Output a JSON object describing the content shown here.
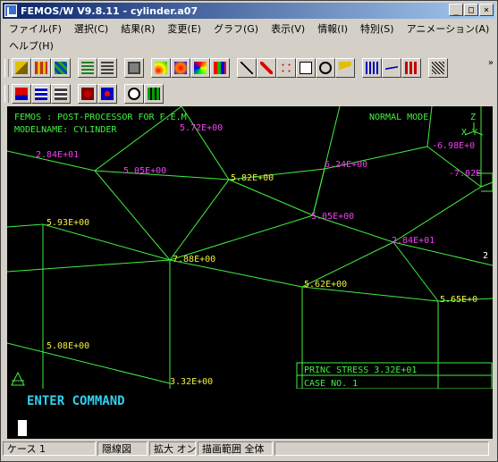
{
  "window": {
    "title": "FEMOS/W V9.8.11 - cylinder.a07",
    "min": "_",
    "max": "□",
    "close": "×"
  },
  "menu": {
    "row1": [
      "ファイル(F)",
      "選択(C)",
      "結果(R)",
      "変更(E)",
      "グラフ(G)",
      "表示(V)",
      "情報(I)",
      "特別(S)",
      "アニメーション(A)"
    ],
    "row2": [
      "ヘルプ(H)"
    ]
  },
  "toolbar": {
    "row1": [
      "open-icon",
      "grid-icon",
      "mesh-icon",
      "layers-icon",
      "layers2-icon",
      "print-icon",
      "contour1-icon",
      "contour2-icon",
      "contour3-icon",
      "contour4-icon",
      "vector-icon",
      "arrow-icon",
      "scatter-icon",
      "l33-icon",
      "circle-icon",
      "deform-icon",
      "graph1-icon",
      "graph2-icon",
      "graph3-icon",
      "spring-icon"
    ],
    "row2": [
      "down-icon",
      "stack-icon",
      "stack-down-icon",
      "gear-icon",
      "move-icon",
      "zoom-icon",
      "fit-icon"
    ],
    "more": "»"
  },
  "canvas": {
    "header_left1": "FEMOS  : POST-PROCESSOR  FOR F.E.M",
    "header_left2": "MODELNAME: CYLINDER",
    "header_right": "NORMAL MODE",
    "axis_z": "Z",
    "axis_xy": "X  Y",
    "labels": [
      {
        "text": "5.72E+00",
        "color": "#f040f0"
      },
      {
        "text": "2.84E+01",
        "color": "#f040f0"
      },
      {
        "text": "5.05E+00",
        "color": "#f040f0"
      },
      {
        "text": "5.82E+00",
        "color": "#f0f040"
      },
      {
        "text": "6.24E+00",
        "color": "#f040f0"
      },
      {
        "text": "-6.98E+0",
        "color": "#f040f0"
      },
      {
        "text": "-7.02E",
        "color": "#f040f0"
      },
      {
        "text": "5.93E+00",
        "color": "#f0f040"
      },
      {
        "text": "5.05E+00",
        "color": "#f040f0"
      },
      {
        "text": "7.88E+00",
        "color": "#f0f040"
      },
      {
        "text": "2.84E+01",
        "color": "#f040f0"
      },
      {
        "text": "5.62E+00",
        "color": "#f0f040"
      },
      {
        "text": "5.65E+0",
        "color": "#f0f040"
      },
      {
        "text": "5.08E+00",
        "color": "#f0f040"
      },
      {
        "text": "3.32E+00",
        "color": "#f0f040"
      },
      {
        "text": "2",
        "color": "#ffffff"
      }
    ],
    "info_box": {
      "line1": "PRINC STRESS   3.32E+01",
      "line2": "CASE NO.          1"
    }
  },
  "command": {
    "prompt": "ENTER COMMAND"
  },
  "status": [
    "ケース 1",
    "隠線図",
    "拡大 オン",
    "描画範囲 全体",
    ""
  ],
  "colors": {
    "mesh": "#40f040",
    "header": "#40f040",
    "prompt": "#30d0f0"
  }
}
